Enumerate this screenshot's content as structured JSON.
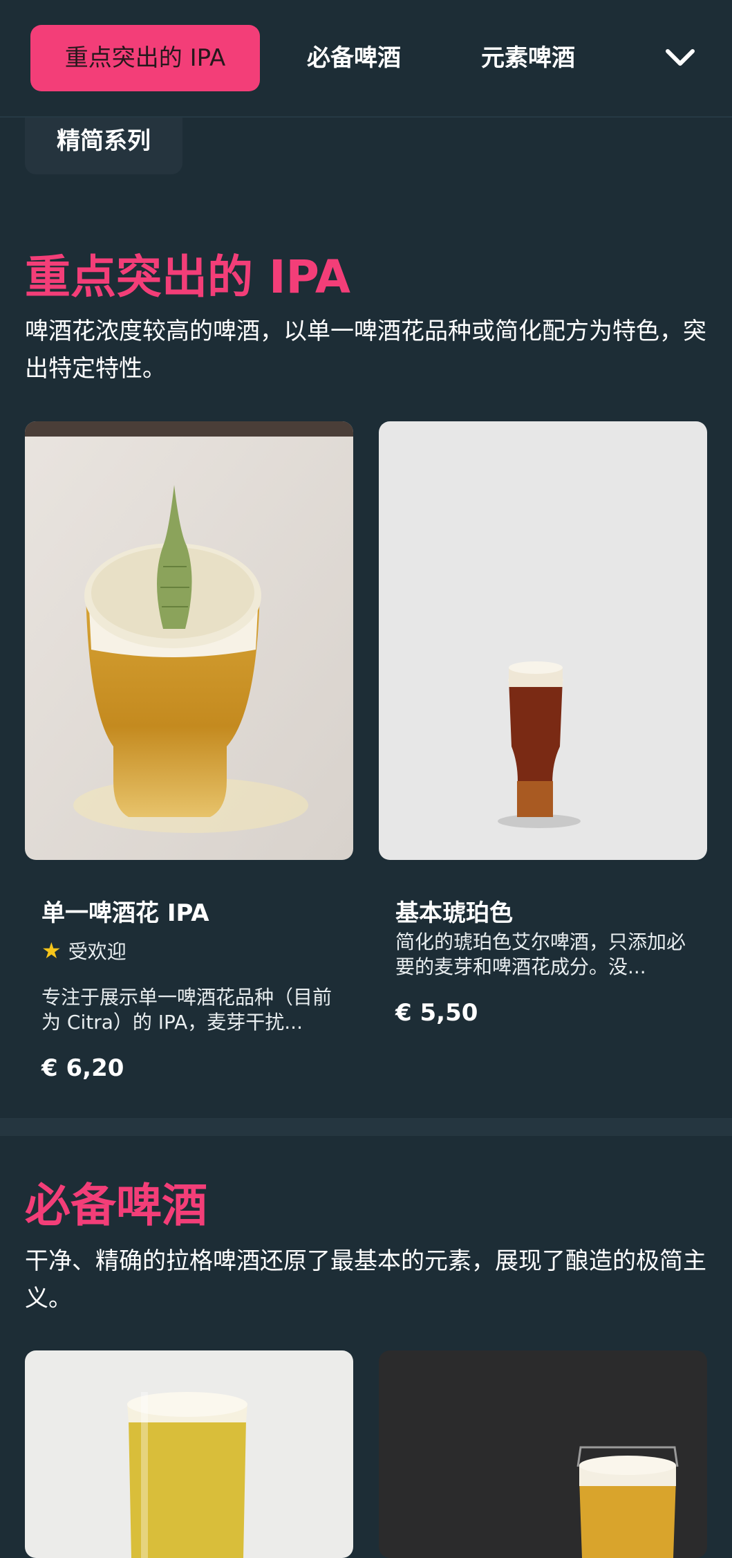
{
  "nav": {
    "tabs": [
      {
        "label": "重点突出的 IPA",
        "active": true
      },
      {
        "label": "必备啤酒",
        "active": false
      },
      {
        "label": "元素啤酒",
        "active": false
      }
    ],
    "more_icon": "chevron-down-icon",
    "chip_label": "精简系列"
  },
  "sections": [
    {
      "title": "重点突出的 IPA",
      "description": "啤酒花浓度较高的啤酒，以单一啤酒花品种或简化配方为特色，突出特定特性。",
      "cards": [
        {
          "name": "单一啤酒花 IPA",
          "badge": "受欢迎",
          "badge_icon": "star-icon",
          "description": "专注于展示单一啤酒花品种（目前为 Citra）的 IPA，麦芽干扰...",
          "price": "€ 6,20"
        },
        {
          "name": "基本琥珀色",
          "description": "简化的琥珀色艾尔啤酒，只添加必要的麦芽和啤酒花成分。没...",
          "price": "€ 5,50"
        }
      ]
    },
    {
      "title": "必备啤酒",
      "description": "干净、精确的拉格啤酒还原了最基本的元素，展现了酿造的极简主义。"
    }
  ],
  "colors": {
    "background": "#1d2d36",
    "accent": "#f33e78",
    "star": "#f6c51b"
  }
}
